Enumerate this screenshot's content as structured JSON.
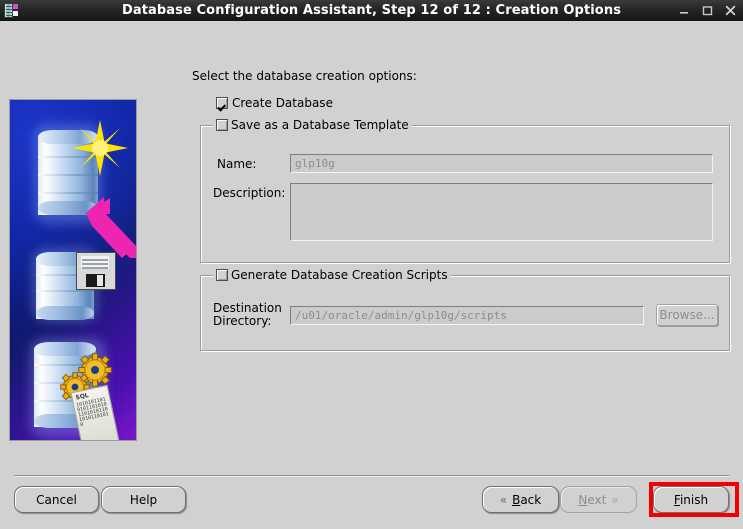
{
  "window": {
    "title": "Database Configuration Assistant, Step 12 of 12 : Creation Options",
    "icon_name": "database-app-icon",
    "minimize_label": "_",
    "maximize_label": "☐",
    "close_label": "✕"
  },
  "main": {
    "intro": "Select the database creation options:",
    "create_database": {
      "label": "Create Database",
      "checked": true
    },
    "template_group": {
      "title": "Save as a Database Template",
      "checked": false,
      "name_label": "Name:",
      "name_value": "glp10g",
      "description_label": "Description:",
      "description_value": ""
    },
    "scripts_group": {
      "title": "Generate Database Creation Scripts",
      "checked": false,
      "destination_label_line1": "Destination",
      "destination_label_line2": "Directory:",
      "destination_value": "/u01/oracle/admin/glp10g/scripts",
      "browse_label": "Browse..."
    }
  },
  "artwork": {
    "name": "database-creation-illustration",
    "scroll_label": "SQL",
    "scroll_bits": "10101011010101101010110101011010101101010",
    "background_start": "#0b1f9e",
    "background_end": "#7a17c9",
    "arrow_color": "#ee25b0",
    "star_color": "#ffe300"
  },
  "footer": {
    "cancel_label": "Cancel",
    "help_label": "Help",
    "back_label": "Back",
    "back_mnemonic": "B",
    "back_rest": "ack",
    "back_icon": "«",
    "next_label": "Next",
    "next_mnemonic": "N",
    "next_rest": "ext",
    "next_icon": "»",
    "next_disabled": true,
    "finish_label": "Finish",
    "finish_mnemonic": "F",
    "finish_rest": "inish",
    "highlight_color": "#f40000"
  }
}
